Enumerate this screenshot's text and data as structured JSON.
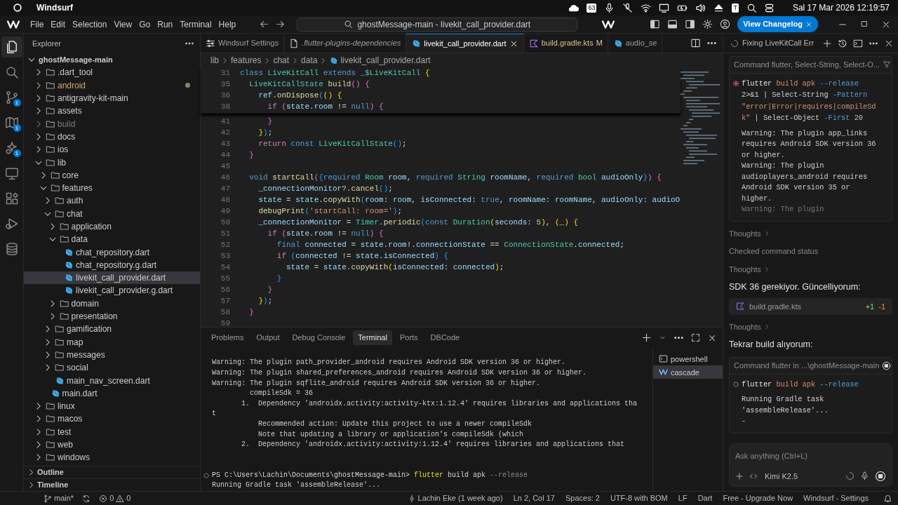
{
  "os_bar": {
    "app": "Windsurf",
    "tray_badge": "63",
    "tray_letter": "T",
    "clock": "Sal 17 Mar 2026 12:19:57"
  },
  "title_bar": {
    "menu": [
      "File",
      "Edit",
      "Selection",
      "View",
      "Go",
      "Run",
      "Terminal",
      "Help"
    ],
    "search": "ghostMessage-main - livekit_call_provider.dart",
    "changelog_button": "View Changelog"
  },
  "activity_bar": [
    {
      "kind": "files",
      "selected": true
    },
    {
      "kind": "search",
      "selected": false
    },
    {
      "kind": "branch",
      "badge": "1",
      "selected": false
    },
    {
      "kind": "map",
      "badge": "1",
      "selected": false
    },
    {
      "kind": "sparkle",
      "badge": "1",
      "selected": false
    },
    {
      "kind": "remote",
      "selected": false
    },
    {
      "kind": "blocks",
      "selected": false
    },
    {
      "kind": "run",
      "selected": false
    },
    {
      "kind": "db",
      "selected": false
    }
  ],
  "explorer": {
    "title": "Explorer",
    "root": {
      "label": "ghostMessage-main",
      "expanded": true
    },
    "tree": [
      {
        "label": ".dart_tool",
        "kind": "folder",
        "expanded": false,
        "selected": false,
        "modified": false,
        "dimmed": false
      },
      {
        "label": "android",
        "kind": "folder",
        "expanded": false,
        "selected": false,
        "modified": true,
        "dimmed": false
      },
      {
        "label": "antigravity-kit-main",
        "kind": "folder",
        "expanded": false,
        "selected": false,
        "modified": false,
        "dimmed": false
      },
      {
        "label": "assets",
        "kind": "folder",
        "expanded": false,
        "selected": false,
        "modified": false,
        "dimmed": false
      },
      {
        "label": "build",
        "kind": "folder",
        "expanded": false,
        "selected": false,
        "modified": false,
        "dimmed": true
      },
      {
        "label": "docs",
        "kind": "folder",
        "expanded": false,
        "selected": false,
        "modified": false,
        "dimmed": false
      },
      {
        "label": "ios",
        "kind": "folder",
        "expanded": false,
        "selected": false,
        "modified": false,
        "dimmed": false
      },
      {
        "label": "lib",
        "kind": "folder",
        "expanded": true,
        "selected": false,
        "modified": false,
        "dimmed": false,
        "children": [
          {
            "label": "core",
            "kind": "folder",
            "expanded": false,
            "selected": false,
            "modified": false,
            "dimmed": false
          },
          {
            "label": "features",
            "kind": "folder",
            "expanded": true,
            "selected": false,
            "modified": false,
            "dimmed": false,
            "children": [
              {
                "label": "auth",
                "kind": "folder",
                "expanded": false,
                "selected": false,
                "modified": false,
                "dimmed": false
              },
              {
                "label": "chat",
                "kind": "folder",
                "expanded": true,
                "selected": false,
                "modified": false,
                "dimmed": false,
                "children": [
                  {
                    "label": "application",
                    "kind": "folder",
                    "expanded": false,
                    "selected": false,
                    "modified": false,
                    "dimmed": false
                  },
                  {
                    "label": "data",
                    "kind": "folder",
                    "expanded": true,
                    "selected": false,
                    "modified": false,
                    "dimmed": false,
                    "children": [
                      {
                        "label": "chat_repository.dart",
                        "kind": "file",
                        "selected": false,
                        "modified": false,
                        "dimmed": false
                      },
                      {
                        "label": "chat_repository.g.dart",
                        "kind": "file",
                        "selected": false,
                        "modified": false,
                        "dimmed": false
                      },
                      {
                        "label": "livekit_call_provider.dart",
                        "kind": "file",
                        "selected": true,
                        "modified": false,
                        "dimmed": false
                      },
                      {
                        "label": "livekit_call_provider.g.dart",
                        "kind": "file",
                        "selected": false,
                        "modified": false,
                        "dimmed": false
                      }
                    ]
                  },
                  {
                    "label": "domain",
                    "kind": "folder",
                    "expanded": false,
                    "selected": false,
                    "modified": false,
                    "dimmed": false
                  },
                  {
                    "label": "presentation",
                    "kind": "folder",
                    "expanded": false,
                    "selected": false,
                    "modified": false,
                    "dimmed": false
                  }
                ]
              },
              {
                "label": "gamification",
                "kind": "folder",
                "expanded": false,
                "selected": false,
                "modified": false,
                "dimmed": false
              },
              {
                "label": "map",
                "kind": "folder",
                "expanded": false,
                "selected": false,
                "modified": false,
                "dimmed": false
              },
              {
                "label": "messages",
                "kind": "folder",
                "expanded": false,
                "selected": false,
                "modified": false,
                "dimmed": false
              },
              {
                "label": "social",
                "kind": "folder",
                "expanded": false,
                "selected": false,
                "modified": false,
                "dimmed": false
              },
              {
                "label": "main_nav_screen.dart",
                "kind": "file",
                "selected": false,
                "modified": false,
                "dimmed": false
              }
            ]
          },
          {
            "label": "main.dart",
            "kind": "file",
            "selected": false,
            "modified": false,
            "dimmed": false
          }
        ]
      },
      {
        "label": "linux",
        "kind": "folder",
        "expanded": false,
        "selected": false,
        "modified": false,
        "dimmed": false
      },
      {
        "label": "macos",
        "kind": "folder",
        "expanded": false,
        "selected": false,
        "modified": false,
        "dimmed": false
      },
      {
        "label": "test",
        "kind": "folder",
        "expanded": false,
        "selected": false,
        "modified": false,
        "dimmed": false
      },
      {
        "label": "web",
        "kind": "folder",
        "expanded": false,
        "selected": false,
        "modified": false,
        "dimmed": false
      },
      {
        "label": "windows",
        "kind": "folder",
        "expanded": false,
        "selected": false,
        "modified": false,
        "dimmed": false
      }
    ],
    "sections": [
      {
        "label": "Outline",
        "expanded": false
      },
      {
        "label": "Timeline",
        "expanded": false
      }
    ]
  },
  "editor_tabs": [
    {
      "label": "Windsurf Settings",
      "kind": "settings",
      "preview": false,
      "selected": false
    },
    {
      "label": ".flutter-plugins-dependencies",
      "kind": "file",
      "preview": true,
      "selected": false
    },
    {
      "label": "livekit_call_provider.dart",
      "kind": "dart",
      "preview": false,
      "selected": true
    },
    {
      "label": "build.gradle.kts",
      "kind": "kotlin",
      "preview": false,
      "selected": false,
      "status": "M"
    },
    {
      "label": "audio_se",
      "kind": "dart",
      "preview": false,
      "selected": false
    }
  ],
  "breadcrumb": [
    "lib",
    "features",
    "chat",
    "data",
    "livekit_call_provider.dart"
  ],
  "sticky_lines": [
    {
      "no": "31",
      "tokens": [
        {
          "kind": "kw",
          "text": "class "
        },
        {
          "kind": "type",
          "text": "LiveKitCall"
        },
        {
          "kind": "kw",
          "text": " extends "
        },
        {
          "kind": "type",
          "text": "_$LiveKitCall"
        },
        {
          "kind": "b1",
          "text": " {"
        }
      ]
    },
    {
      "no": "35",
      "tokens": [
        {
          "kind": "type",
          "text": "  LiveKitCallState"
        },
        {
          "kind": "fn",
          "text": " build"
        },
        {
          "kind": "b2",
          "text": "() {"
        }
      ]
    },
    {
      "no": "36",
      "tokens": [
        {
          "kind": "var",
          "text": "    ref"
        },
        {
          "kind": "p",
          "text": "."
        },
        {
          "kind": "fn",
          "text": "onDispose"
        },
        {
          "kind": "b3",
          "text": "("
        },
        {
          "kind": "b1",
          "text": "() {"
        }
      ]
    },
    {
      "no": "38",
      "tokens": [
        {
          "kind": "ctl",
          "text": "      if"
        },
        {
          "kind": "b2",
          "text": " ("
        },
        {
          "kind": "var",
          "text": "state"
        },
        {
          "kind": "p",
          "text": "."
        },
        {
          "kind": "var",
          "text": "room"
        },
        {
          "kind": "p",
          "text": " != "
        },
        {
          "kind": "kw",
          "text": "null"
        },
        {
          "kind": "b2",
          "text": ") {"
        }
      ]
    }
  ],
  "code_lines": [
    {
      "no": "41",
      "tokens": [
        {
          "kind": "b2",
          "text": "      }"
        }
      ]
    },
    {
      "no": "42",
      "tokens": [
        {
          "kind": "b1",
          "text": "    }"
        },
        {
          "kind": "b3",
          "text": ")"
        },
        {
          "kind": "p",
          "text": ";"
        }
      ]
    },
    {
      "no": "43",
      "tokens": [
        {
          "kind": "ctl",
          "text": "    return"
        },
        {
          "kind": "kw",
          "text": " const"
        },
        {
          "kind": "type",
          "text": " LiveKitCallState"
        },
        {
          "kind": "b3",
          "text": "()"
        },
        {
          "kind": "p",
          "text": ";"
        }
      ]
    },
    {
      "no": "44",
      "tokens": [
        {
          "kind": "b2",
          "text": "  }"
        }
      ]
    },
    {
      "no": "45"
    },
    {
      "no": "46",
      "tokens": [
        {
          "kind": "kw",
          "text": "  void"
        },
        {
          "kind": "fn",
          "text": " startCall"
        },
        {
          "kind": "b2",
          "text": "("
        },
        {
          "kind": "b3",
          "text": "{"
        },
        {
          "kind": "kw",
          "text": "required"
        },
        {
          "kind": "type",
          "text": " Room"
        },
        {
          "kind": "var",
          "text": " room"
        },
        {
          "kind": "p",
          "text": ", "
        },
        {
          "kind": "kw",
          "text": "required"
        },
        {
          "kind": "type",
          "text": " String"
        },
        {
          "kind": "var",
          "text": " roomName"
        },
        {
          "kind": "p",
          "text": ", "
        },
        {
          "kind": "kw",
          "text": "required"
        },
        {
          "kind": "type",
          "text": " bool"
        },
        {
          "kind": "var",
          "text": " audioOnly"
        },
        {
          "kind": "b3",
          "text": "}"
        },
        {
          "kind": "b2",
          "text": ") {"
        }
      ]
    },
    {
      "no": "47",
      "tokens": [
        {
          "kind": "var",
          "text": "    _connectionMonitor"
        },
        {
          "kind": "p",
          "text": "?."
        },
        {
          "kind": "fn",
          "text": "cancel"
        },
        {
          "kind": "b3",
          "text": "()"
        },
        {
          "kind": "p",
          "text": ";"
        }
      ]
    },
    {
      "no": "48",
      "tokens": [
        {
          "kind": "var",
          "text": "    state"
        },
        {
          "kind": "p",
          "text": " = "
        },
        {
          "kind": "var",
          "text": "state"
        },
        {
          "kind": "p",
          "text": "."
        },
        {
          "kind": "fn",
          "text": "copyWith"
        },
        {
          "kind": "b3",
          "text": "("
        },
        {
          "kind": "var",
          "text": "room"
        },
        {
          "kind": "p",
          "text": ": "
        },
        {
          "kind": "var",
          "text": "room"
        },
        {
          "kind": "p",
          "text": ", "
        },
        {
          "kind": "var",
          "text": "isConnected"
        },
        {
          "kind": "p",
          "text": ": "
        },
        {
          "kind": "kw",
          "text": "true"
        },
        {
          "kind": "p",
          "text": ", "
        },
        {
          "kind": "var",
          "text": "roomName"
        },
        {
          "kind": "p",
          "text": ": "
        },
        {
          "kind": "var",
          "text": "roomName"
        },
        {
          "kind": "p",
          "text": ", "
        },
        {
          "kind": "var",
          "text": "audioOnly"
        },
        {
          "kind": "p",
          "text": ": "
        },
        {
          "kind": "var",
          "text": "audioO"
        }
      ]
    },
    {
      "no": "49",
      "tokens": [
        {
          "kind": "fn",
          "text": "    debugPrint"
        },
        {
          "kind": "b3",
          "text": "("
        },
        {
          "kind": "str",
          "text": "'startCall: room='"
        },
        {
          "kind": "b3",
          "text": ")"
        },
        {
          "kind": "p",
          "text": ";"
        }
      ]
    },
    {
      "no": "50",
      "tokens": [
        {
          "kind": "var",
          "text": "    _connectionMonitor"
        },
        {
          "kind": "p",
          "text": " = "
        },
        {
          "kind": "type",
          "text": "Timer"
        },
        {
          "kind": "p",
          "text": "."
        },
        {
          "kind": "fn",
          "text": "periodic"
        },
        {
          "kind": "b3",
          "text": "("
        },
        {
          "kind": "kw",
          "text": "const"
        },
        {
          "kind": "type",
          "text": " Duration"
        },
        {
          "kind": "b1",
          "text": "("
        },
        {
          "kind": "var",
          "text": "seconds"
        },
        {
          "kind": "p",
          "text": ": "
        },
        {
          "kind": "num",
          "text": "5"
        },
        {
          "kind": "b1",
          "text": ")"
        },
        {
          "kind": "p",
          "text": ", "
        },
        {
          "kind": "b1",
          "text": "("
        },
        {
          "kind": "var",
          "text": "_"
        },
        {
          "kind": "b1",
          "text": ") {"
        }
      ]
    },
    {
      "no": "51",
      "tokens": [
        {
          "kind": "ctl",
          "text": "      if"
        },
        {
          "kind": "b2",
          "text": " ("
        },
        {
          "kind": "var",
          "text": "state"
        },
        {
          "kind": "p",
          "text": "."
        },
        {
          "kind": "var",
          "text": "room"
        },
        {
          "kind": "p",
          "text": " != "
        },
        {
          "kind": "kw",
          "text": "null"
        },
        {
          "kind": "b2",
          "text": ") {"
        }
      ]
    },
    {
      "no": "52",
      "tokens": [
        {
          "kind": "kw",
          "text": "        final"
        },
        {
          "kind": "var",
          "text": " connected"
        },
        {
          "kind": "p",
          "text": " = "
        },
        {
          "kind": "var",
          "text": "state"
        },
        {
          "kind": "p",
          "text": "."
        },
        {
          "kind": "var",
          "text": "room"
        },
        {
          "kind": "p",
          "text": "!."
        },
        {
          "kind": "var",
          "text": "connectionState"
        },
        {
          "kind": "p",
          "text": " == "
        },
        {
          "kind": "type",
          "text": "ConnectionState"
        },
        {
          "kind": "p",
          "text": "."
        },
        {
          "kind": "var",
          "text": "connected"
        },
        {
          "kind": "p",
          "text": ";"
        }
      ]
    },
    {
      "no": "53",
      "tokens": [
        {
          "kind": "ctl",
          "text": "        if"
        },
        {
          "kind": "b3",
          "text": " ("
        },
        {
          "kind": "var",
          "text": "connected"
        },
        {
          "kind": "p",
          "text": " != "
        },
        {
          "kind": "var",
          "text": "state"
        },
        {
          "kind": "p",
          "text": "."
        },
        {
          "kind": "var",
          "text": "isConnected"
        },
        {
          "kind": "b3",
          "text": ") {"
        }
      ]
    },
    {
      "no": "54",
      "tokens": [
        {
          "kind": "var",
          "text": "          state"
        },
        {
          "kind": "p",
          "text": " = "
        },
        {
          "kind": "var",
          "text": "state"
        },
        {
          "kind": "p",
          "text": "."
        },
        {
          "kind": "fn",
          "text": "copyWith"
        },
        {
          "kind": "b1",
          "text": "("
        },
        {
          "kind": "var",
          "text": "isConnected"
        },
        {
          "kind": "p",
          "text": ": "
        },
        {
          "kind": "var",
          "text": "connected"
        },
        {
          "kind": "b1",
          "text": ")"
        },
        {
          "kind": "p",
          "text": ";"
        }
      ]
    },
    {
      "no": "55",
      "tokens": [
        {
          "kind": "b3",
          "text": "        }"
        }
      ]
    },
    {
      "no": "56",
      "tokens": [
        {
          "kind": "b2",
          "text": "      }"
        }
      ]
    },
    {
      "no": "57",
      "tokens": [
        {
          "kind": "b1",
          "text": "    }"
        },
        {
          "kind": "b3",
          "text": ")"
        },
        {
          "kind": "p",
          "text": ";"
        }
      ]
    },
    {
      "no": "58",
      "tokens": [
        {
          "kind": "b2",
          "text": "  }"
        }
      ]
    },
    {
      "no": "59"
    }
  ],
  "panel": {
    "tabs": [
      {
        "label": "Problems",
        "selected": false
      },
      {
        "label": "Output",
        "selected": false
      },
      {
        "label": "Debug Console",
        "selected": false
      },
      {
        "label": "Terminal",
        "selected": true
      },
      {
        "label": "Ports",
        "selected": false
      },
      {
        "label": "DBCode",
        "selected": false
      }
    ],
    "terminal_lines": [
      "Warning: The plugin path_provider_android requires Android SDK version 36 or higher.",
      "Warning: The plugin shared_preferences_android requires Android SDK version 36 or higher.",
      "Warning: The plugin sqflite_android requires Android SDK version 36 or higher.",
      "         compileSdk = 36",
      "       1.  Dependency 'androidx.activity:activity-ktx:1.12.4' requires libraries and applications tha",
      "t",
      "           Recommended action: Update this project to use a newer compileSdk",
      "           Note that updating a library or application's compileSdk (which",
      "       2.  Dependency 'androidx.activity:activity:1.12.4' requires libraries and applications that"
    ],
    "prompt": [
      {
        "kind": "p",
        "text": "PS C:\\Users\\Lachin\\Documents\\ghostMessage-main> "
      },
      {
        "kind": "y",
        "text": "flutter"
      },
      {
        "kind": "p",
        "text": " build apk "
      },
      {
        "kind": "g",
        "text": "--release"
      }
    ],
    "last_line": "Running Gradle task 'assembleRelease'...",
    "sessions": [
      {
        "label": "powershell",
        "kind": "shell",
        "selected": false
      },
      {
        "label": "cascade",
        "kind": "cascade",
        "selected": true
      }
    ]
  },
  "chat": {
    "title": "Fixing LiveKitCall Err",
    "items": [
      {
        "kind": "command",
        "header": "Command flutter, Select-String, Select-O...",
        "running": false,
        "command_lines": [
          [
            {
              "kind": "w",
              "text": "flutter"
            },
            {
              "kind": "s",
              "text": " build apk"
            },
            {
              "kind": "o",
              "text": " --release"
            }
          ],
          [
            {
              "kind": "p",
              "text": "2>&1 | Select-String "
            },
            {
              "kind": "o",
              "text": "-Pattern"
            }
          ],
          [
            {
              "kind": "s",
              "text": "\"error|Error|requires|compileSd"
            }
          ],
          [
            {
              "kind": "s",
              "text": "k\""
            },
            {
              "kind": "p",
              "text": " | Select-Object "
            },
            {
              "kind": "o",
              "text": "-First"
            },
            {
              "kind": "n",
              "text": " 20"
            }
          ]
        ],
        "output": [
          "Warning: The plugin app_links",
          "requires Android SDK version 36",
          "or higher.",
          "Warning: The plugin",
          "audioplayers_android requires",
          "Android SDK version 35 or",
          "higher.",
          "Warning: The plugin"
        ]
      },
      {
        "kind": "thoughts",
        "text": "Thoughts"
      },
      {
        "kind": "status",
        "text": "Checked command status"
      },
      {
        "kind": "thoughts",
        "text": "Thoughts"
      },
      {
        "kind": "message",
        "text": "SDK 36 gerekiyor. Güncelliyorum:"
      },
      {
        "kind": "file",
        "name": "build.gradle.kts",
        "added": "+1",
        "removed": "-1"
      },
      {
        "kind": "thoughts",
        "text": "Thoughts"
      },
      {
        "kind": "message",
        "text": "Tekrar build alıyorum:"
      },
      {
        "kind": "command",
        "header": "Command flutter in ...\\ghostMessage-main",
        "running": true,
        "command_lines": [
          [
            {
              "kind": "w",
              "text": "flutter"
            },
            {
              "kind": "s",
              "text": " build apk"
            },
            {
              "kind": "o",
              "text": " --release"
            }
          ]
        ],
        "output": [
          "Running Gradle task",
          "'assembleRelease'...",
          "-"
        ]
      }
    ],
    "input": {
      "placeholder": "Ask anything (Ctrl+L)",
      "model": "Kimi K2.5"
    }
  },
  "status_bar": {
    "branch": "main*",
    "errors": "0",
    "warnings": "0",
    "right": [
      {
        "kind": "blame",
        "text": "Lachin Eke (1 week ago)"
      },
      {
        "kind": "position",
        "text": "Ln 2, Col 17"
      },
      {
        "kind": "indent",
        "text": "Spaces: 2"
      },
      {
        "kind": "encoding",
        "text": "UTF-8 with BOM"
      },
      {
        "kind": "eol",
        "text": "LF"
      },
      {
        "kind": "language",
        "text": "Dart"
      },
      {
        "kind": "plan",
        "text": "Free - Upgrade Now"
      },
      {
        "kind": "settings",
        "text": "Windsurf - Settings"
      }
    ]
  }
}
